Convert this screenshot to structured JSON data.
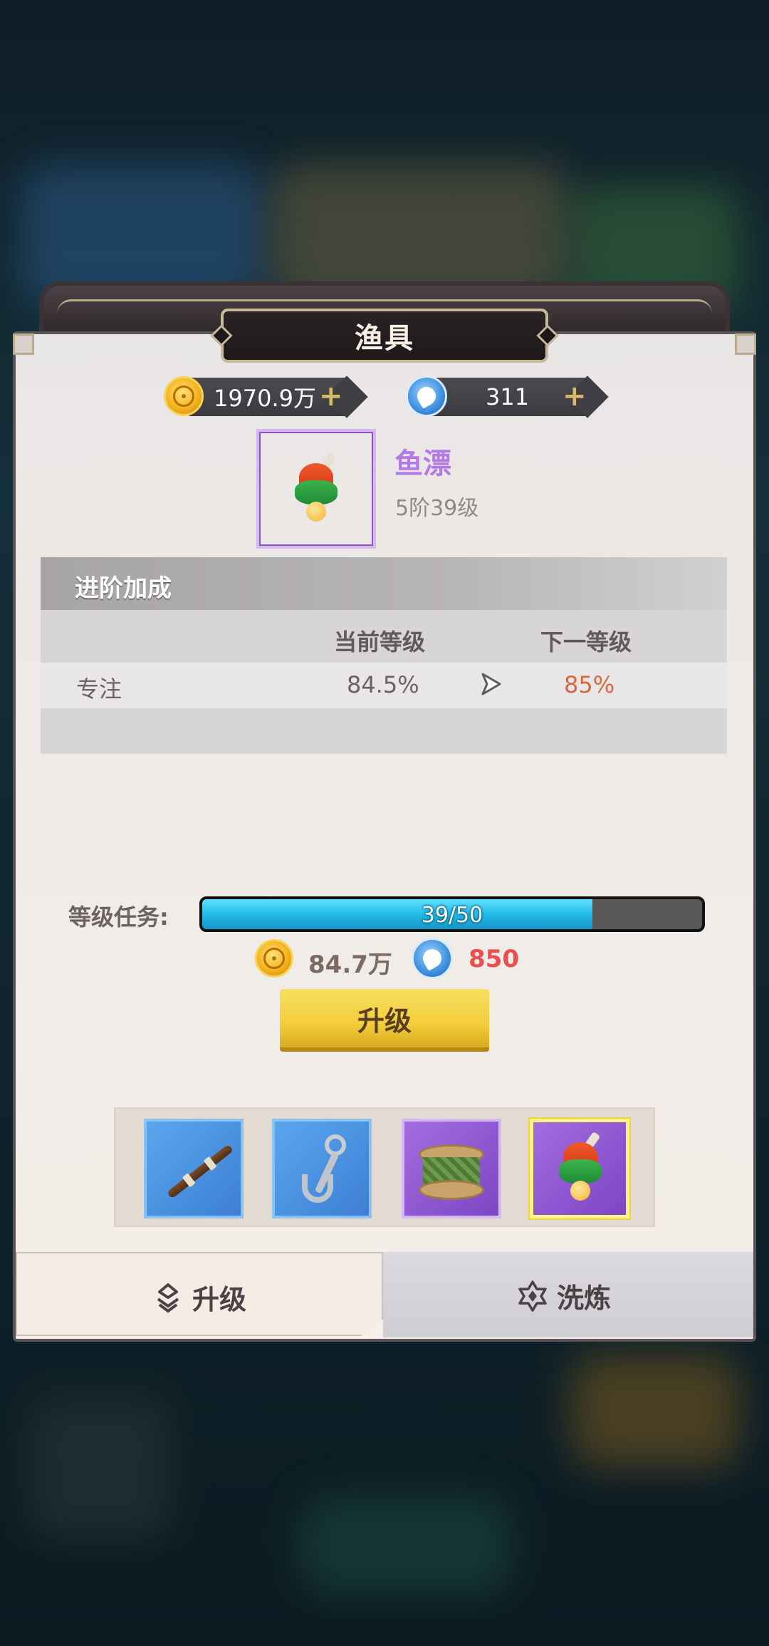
{
  "panel": {
    "title": "渔具"
  },
  "currency": {
    "gold": {
      "value": "1970.9万",
      "icon": "gold-coin-icon",
      "plus": "+"
    },
    "fish": {
      "value": "311",
      "icon": "fish-token-icon",
      "plus": "+"
    }
  },
  "item": {
    "name": "鱼漂",
    "level": "5阶39级",
    "icon": "bobber-icon",
    "name_color": "#b479e6"
  },
  "bonus": {
    "header": "进阶加成",
    "columns": [
      "",
      "当前等级",
      "",
      "下一等级"
    ],
    "rows": [
      {
        "stat": "专注",
        "current": "84.5%",
        "next": "85%"
      }
    ]
  },
  "task": {
    "label": "等级任务:",
    "current": 39,
    "total": 50,
    "text": "39/50"
  },
  "cost": {
    "gold": "84.7万",
    "fish": "850",
    "fish_color": "#ee4d4d"
  },
  "upgrade_button": "升级",
  "gear_slots": [
    {
      "name": "fishing-rod-icon",
      "rarity": "blue",
      "selected": false
    },
    {
      "name": "hook-icon",
      "rarity": "blue",
      "selected": false
    },
    {
      "name": "line-spool-icon",
      "rarity": "purple",
      "selected": false
    },
    {
      "name": "bobber-icon",
      "rarity": "purple",
      "selected": true
    }
  ],
  "tabs": [
    {
      "label": "升级",
      "icon": "upgrade-icon",
      "active": true
    },
    {
      "label": "洗炼",
      "icon": "refine-icon",
      "active": false
    }
  ]
}
